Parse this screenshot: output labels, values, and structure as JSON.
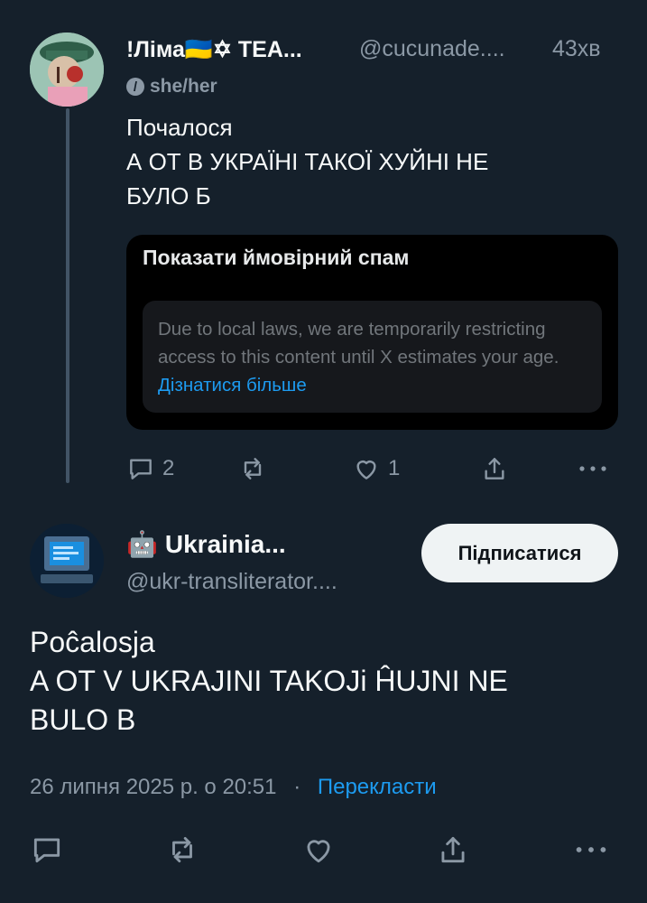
{
  "tweet1": {
    "display_name": "!Ліма🇺🇦✡ TEA...",
    "handle": "@cucunade....",
    "time": "43хв",
    "pronouns": "she/her",
    "text_line1": "Почалося",
    "text_line2": "А ОТ В УКРАЇНІ ТАКОЇ ХУЙНІ НЕ",
    "text_line3": "БУЛО Б",
    "notice": {
      "title": "Показати ймовірний спам",
      "message": "Due to local laws, we are temporarily restricting access to this content until X estimates your age.",
      "link": "Дізнатися більше"
    },
    "actions": {
      "reply_count": "2",
      "like_count": "1"
    }
  },
  "tweet2": {
    "bot_emoji": "🤖",
    "display_name": "Ukrainia...",
    "handle": "@ukr-transliterator....",
    "follow_label": "Підписатися",
    "text_line1": "Poĉalosja",
    "text_line2": "A OT V UKRAJINI TAKOJi ĤUJNI NE",
    "text_line3": "BULO B",
    "date": "26 липня 2025 р. о 20:51",
    "separator": "·",
    "translate_label": "Перекласти"
  },
  "colors": {
    "background": "#15202b",
    "accent": "#1d9bf0",
    "muted": "#8b98a5"
  }
}
